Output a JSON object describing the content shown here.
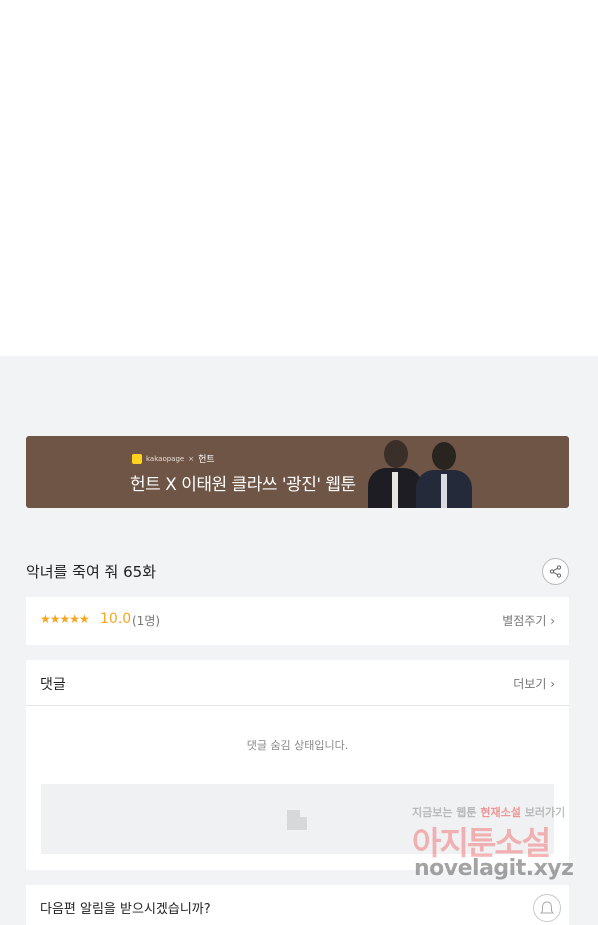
{
  "banner": {
    "brand_small": "kakaopage",
    "brand_x": "×",
    "brand_partner": "헌트",
    "headline": "헌트 X 이태원 클라쓰 '광진' 웹툰"
  },
  "episode": {
    "title": "악녀를 죽여 줘 65화"
  },
  "rating": {
    "stars": "★★★★★",
    "score": "10.0",
    "count": "(1명)",
    "rate_link": "별점주기 ›"
  },
  "comments": {
    "title": "댓글",
    "more_link": "더보기 ›",
    "hidden_message": "댓글 숨김 상태입니다."
  },
  "next_alert": {
    "text": "다음편 알림을 받으시겠습니까?"
  },
  "watermark": {
    "line1_prefix": "지금보는 웹툰",
    "line1_emph": "현재소설",
    "line1_suffix": "보러가기",
    "main": "아지툰소설",
    "url": "novelagit.xyz"
  },
  "colors": {
    "banner_bg": "#6f5545",
    "accent_star": "#f5a623",
    "page_bg": "#f2f3f5"
  },
  "icons": {
    "share": "share-icon",
    "bell": "bell-icon",
    "placeholder": "image-placeholder-icon"
  }
}
